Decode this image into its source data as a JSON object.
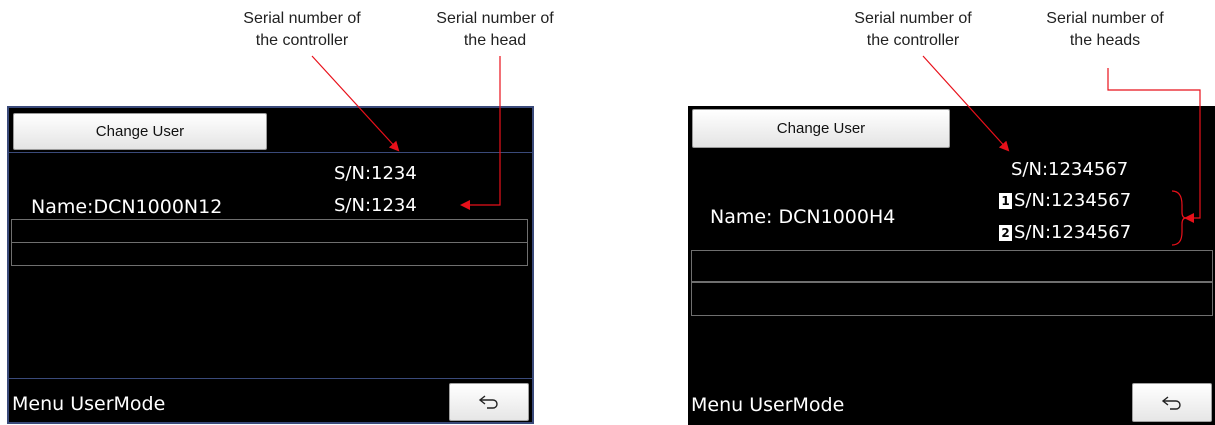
{
  "left_panel": {
    "callout_controller": "Serial number of\nthe controller",
    "callout_head": "Serial number of\nthe head",
    "change_user_label": "Change User",
    "controller_sn": "S/N:1234",
    "name": "Name:DCN1000N12",
    "head_sn": "S/N:1234",
    "footer_label": "Menu UserMode",
    "back_icon": "return-arrow-icon"
  },
  "right_panel": {
    "callout_controller": "Serial number of\nthe controller",
    "callout_heads": "Serial number of\nthe heads",
    "change_user_label": "Change User",
    "controller_sn": "S/N:1234567",
    "name": "Name: DCN1000H4",
    "head1_badge": "1",
    "head1_sn": "S/N:1234567",
    "head2_badge": "2",
    "head2_sn": "S/N:1234567",
    "footer_label": "Menu UserMode",
    "back_icon": "return-arrow-icon"
  },
  "colors": {
    "arrow": "#e8101a",
    "screen": "#000000",
    "screen_border": "#3a4a7a"
  }
}
